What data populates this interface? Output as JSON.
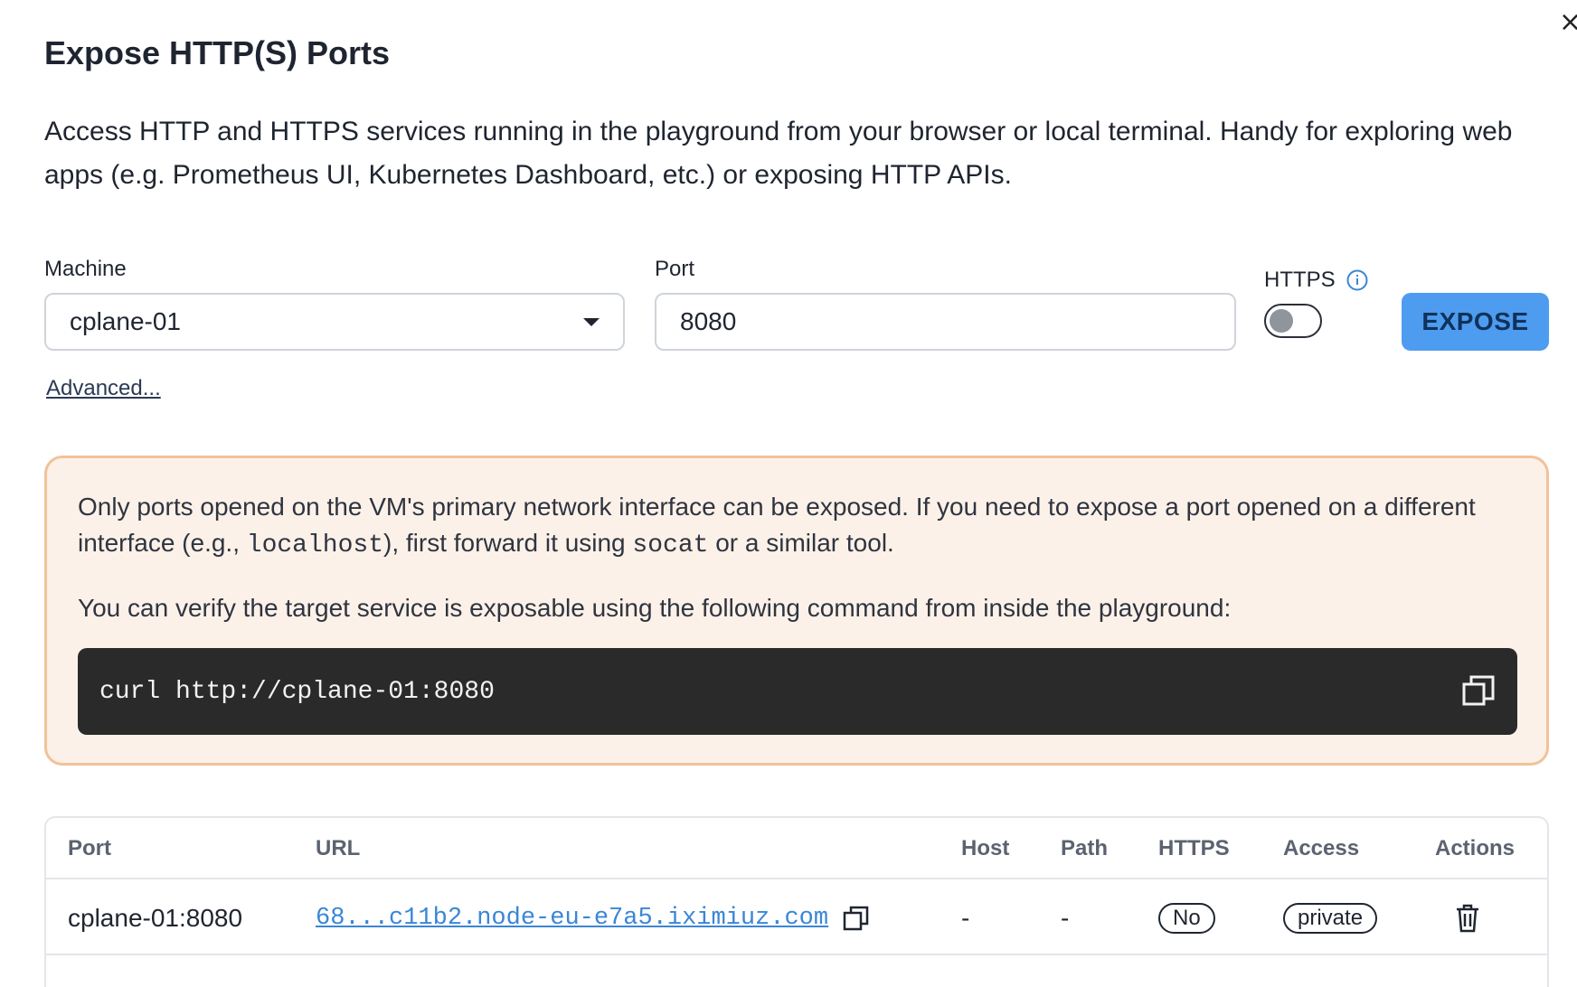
{
  "dialog": {
    "title": "Expose HTTP(S) Ports",
    "close_label": "×",
    "description": "Access HTTP and HTTPS services running in the playground from your browser or local terminal. Handy for exploring web apps (e.g. Prometheus UI, Kubernetes Dashboard, etc.) or exposing HTTP APIs."
  },
  "form": {
    "machine_label": "Machine",
    "machine_value": "cplane-01",
    "port_label": "Port",
    "port_value": "8080",
    "https_label": "HTTPS",
    "https_enabled": false,
    "expose_label": "EXPOSE",
    "advanced_label": "Advanced..."
  },
  "notice": {
    "p1_before": "Only ports opened on the VM's primary network interface can be exposed. If you need to expose a port opened on a different interface (e.g., ",
    "p1_code1": "localhost",
    "p1_middle": "), first forward it using ",
    "p1_code2": "socat",
    "p1_after": " or a similar tool.",
    "p2": "You can verify the target service is exposable using the following command from inside the playground:",
    "command": "curl http://cplane-01:8080"
  },
  "table": {
    "headers": {
      "port": "Port",
      "url": "URL",
      "host": "Host",
      "path": "Path",
      "https": "HTTPS",
      "access": "Access",
      "actions": "Actions"
    },
    "rows": [
      {
        "port": "cplane-01:8080",
        "url": "68...c11b2.node-eu-e7a5.iximiuz.com",
        "host": "-",
        "path": "-",
        "https": "No",
        "access": "private"
      }
    ]
  },
  "colors": {
    "accent": "#4e9cf0",
    "notice_bg": "#fcf1e8",
    "notice_border": "#f1c29a",
    "code_bg": "#2a2a2a",
    "link": "#3a86d6"
  },
  "icons": [
    "close-icon",
    "chevron-down-icon",
    "info-icon",
    "copy-icon",
    "trash-icon"
  ]
}
